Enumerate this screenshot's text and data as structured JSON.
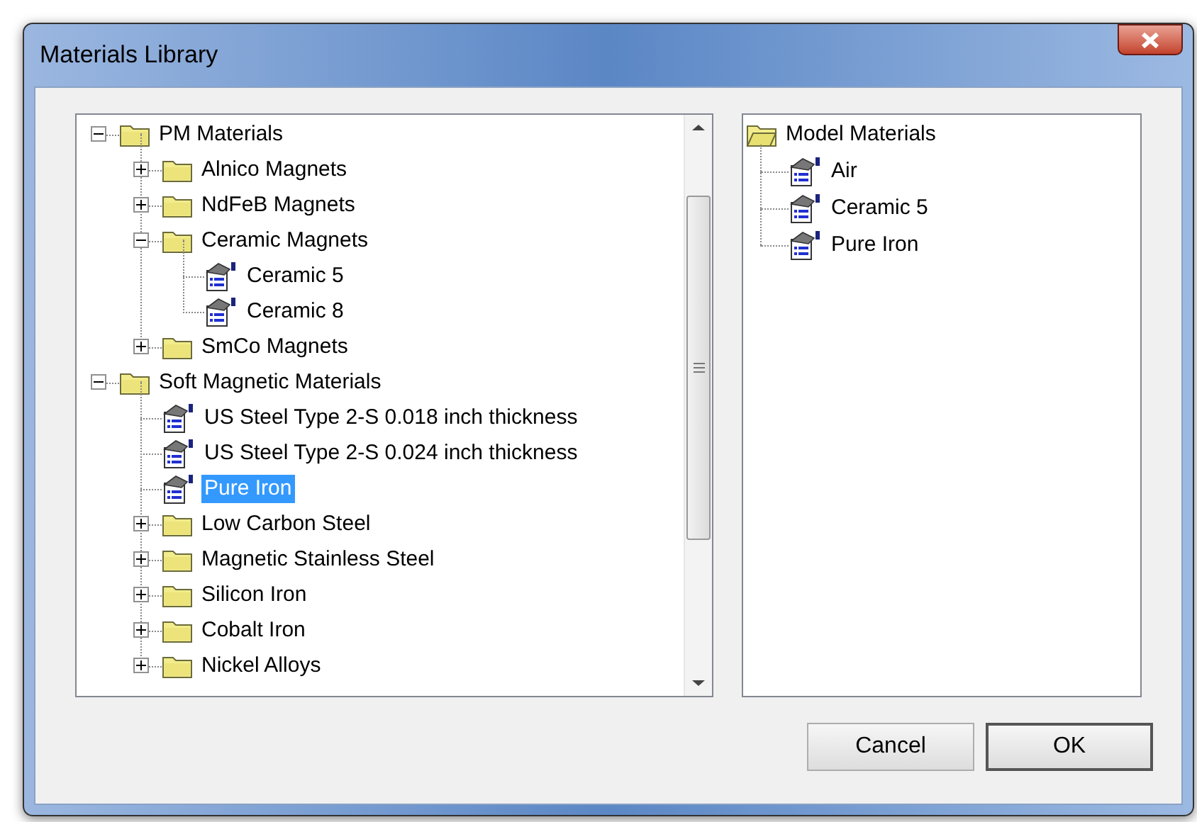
{
  "window": {
    "title": "Materials Library"
  },
  "library_tree": [
    {
      "label": "PM Materials",
      "kind": "folder",
      "expanded": true,
      "selected": false,
      "children": [
        {
          "label": "Alnico Magnets",
          "kind": "folder",
          "expanded": false,
          "selected": false
        },
        {
          "label": "NdFeB Magnets",
          "kind": "folder",
          "expanded": false,
          "selected": false
        },
        {
          "label": "Ceramic Magnets",
          "kind": "folder",
          "expanded": true,
          "selected": false,
          "children": [
            {
              "label": "Ceramic 5",
              "kind": "material",
              "selected": false
            },
            {
              "label": "Ceramic 8",
              "kind": "material",
              "selected": false
            }
          ]
        },
        {
          "label": "SmCo Magnets",
          "kind": "folder",
          "expanded": false,
          "selected": false
        }
      ]
    },
    {
      "label": "Soft Magnetic Materials",
      "kind": "folder",
      "expanded": true,
      "selected": false,
      "children": [
        {
          "label": "US Steel Type 2-S 0.018 inch thickness",
          "kind": "material",
          "selected": false
        },
        {
          "label": "US Steel Type 2-S 0.024 inch thickness",
          "kind": "material",
          "selected": false
        },
        {
          "label": "Pure Iron",
          "kind": "material",
          "selected": true
        },
        {
          "label": "Low Carbon Steel",
          "kind": "folder",
          "expanded": false,
          "selected": false
        },
        {
          "label": "Magnetic Stainless Steel",
          "kind": "folder",
          "expanded": false,
          "selected": false
        },
        {
          "label": "Silicon Iron",
          "kind": "folder",
          "expanded": false,
          "selected": false
        },
        {
          "label": "Cobalt Iron",
          "kind": "folder",
          "expanded": false,
          "selected": false
        },
        {
          "label": "Nickel Alloys",
          "kind": "folder",
          "expanded": false,
          "selected": false
        }
      ]
    }
  ],
  "model_tree": {
    "label": "Model Materials",
    "children": [
      {
        "label": "Air",
        "selected": false
      },
      {
        "label": "Ceramic 5",
        "selected": false
      },
      {
        "label": "Pure Iron",
        "selected": false
      }
    ]
  },
  "buttons": [
    {
      "label": "Cancel",
      "default": false
    },
    {
      "label": "OK",
      "default": true
    }
  ]
}
